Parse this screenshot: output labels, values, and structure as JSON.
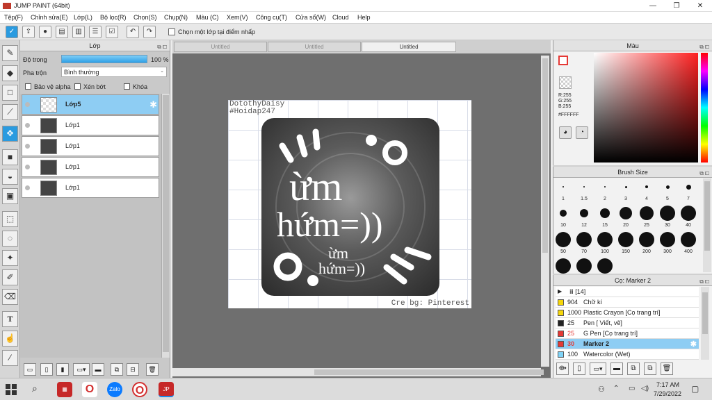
{
  "window": {
    "title": "JUMP PAINT (64bit)",
    "minimize": "—",
    "maximize": "❐",
    "close": "✕"
  },
  "menu": [
    "Tệp(F)",
    "Chỉnh sửa(E)",
    "Lớp(L)",
    "Bộ lọc(R)",
    "Chọn(S)",
    "Chụp(N)",
    "Màu (C)",
    "Xem(V)",
    "Công cụ(T)",
    "Cửa sổ(W)",
    "Cloud",
    "Help"
  ],
  "toolbar": {
    "select_layer_label": "Chọn một lớp tại điểm nhấp"
  },
  "layers_panel": {
    "title": "Lớp",
    "opacity_label": "Độ trong",
    "opacity_value": "100 %",
    "blend_label": "Pha trộn",
    "blend_value": "Bình thường",
    "protect_alpha": "Bảo vệ alpha",
    "clipping": "Xén bớt",
    "lock": "Khóa",
    "layers": [
      {
        "name": "Lớp5",
        "selected": true
      },
      {
        "name": "Lớp1",
        "selected": false
      },
      {
        "name": "Lớp1",
        "selected": false
      },
      {
        "name": "Lớp1",
        "selected": false
      },
      {
        "name": "Lớp1",
        "selected": false
      }
    ]
  },
  "tabs": [
    "Untitled",
    "Untitled",
    "Untitled"
  ],
  "canvas": {
    "credit_top_1": "DotothyDaisy",
    "credit_top_2": "#Hoidap247",
    "text_big_1": "ừm",
    "text_big_2": "hứm=))",
    "text_small_1": "ừm",
    "text_small_2": "hứm=))",
    "credit_bottom": "Cre bg: Pinterest"
  },
  "color_panel": {
    "title": "Màu",
    "r": "R:255",
    "g": "G:255",
    "b": "B:255",
    "hex": "#FFFFFF",
    "accent": "#e53935"
  },
  "brush_size_panel": {
    "title": "Brush Size",
    "sizes": [
      "1",
      "1.5",
      "2",
      "3",
      "4",
      "5",
      "7",
      "10",
      "12",
      "15",
      "20",
      "25",
      "30",
      "40",
      "50",
      "70",
      "100",
      "150",
      "200",
      "300",
      "400"
    ]
  },
  "brush_panel": {
    "title": "Cọ: Marker 2",
    "group": "ⅲ [14]",
    "items": [
      {
        "size": "904",
        "name": "Chữ kí",
        "color": "#f5d60a",
        "selected": false
      },
      {
        "size": "1000",
        "name": "Plastic Crayon [Cọ trang trí]",
        "color": "#f5d60a",
        "selected": false
      },
      {
        "size": "25",
        "name": "Pen [ Viết, vẽ]",
        "color": "#222222",
        "selected": false
      },
      {
        "size": "25",
        "name": "G Pen [Cọ trang trí]",
        "color": "#e53935",
        "selected": false
      },
      {
        "size": "30",
        "name": "Marker 2",
        "color": "#e53935",
        "selected": true
      },
      {
        "size": "100",
        "name": "Watercolor (Wet)",
        "color": "#7fd3f7",
        "selected": false
      }
    ]
  },
  "taskbar": {
    "time": "7:17 AM",
    "date": "7/29/2022",
    "apps": [
      "windows-start-icon",
      "search-icon",
      "app-icon",
      "opera-icon",
      "zalo-icon",
      "opera-gx-icon",
      "jump-paint-icon"
    ],
    "zalo_label": "Zalo"
  }
}
